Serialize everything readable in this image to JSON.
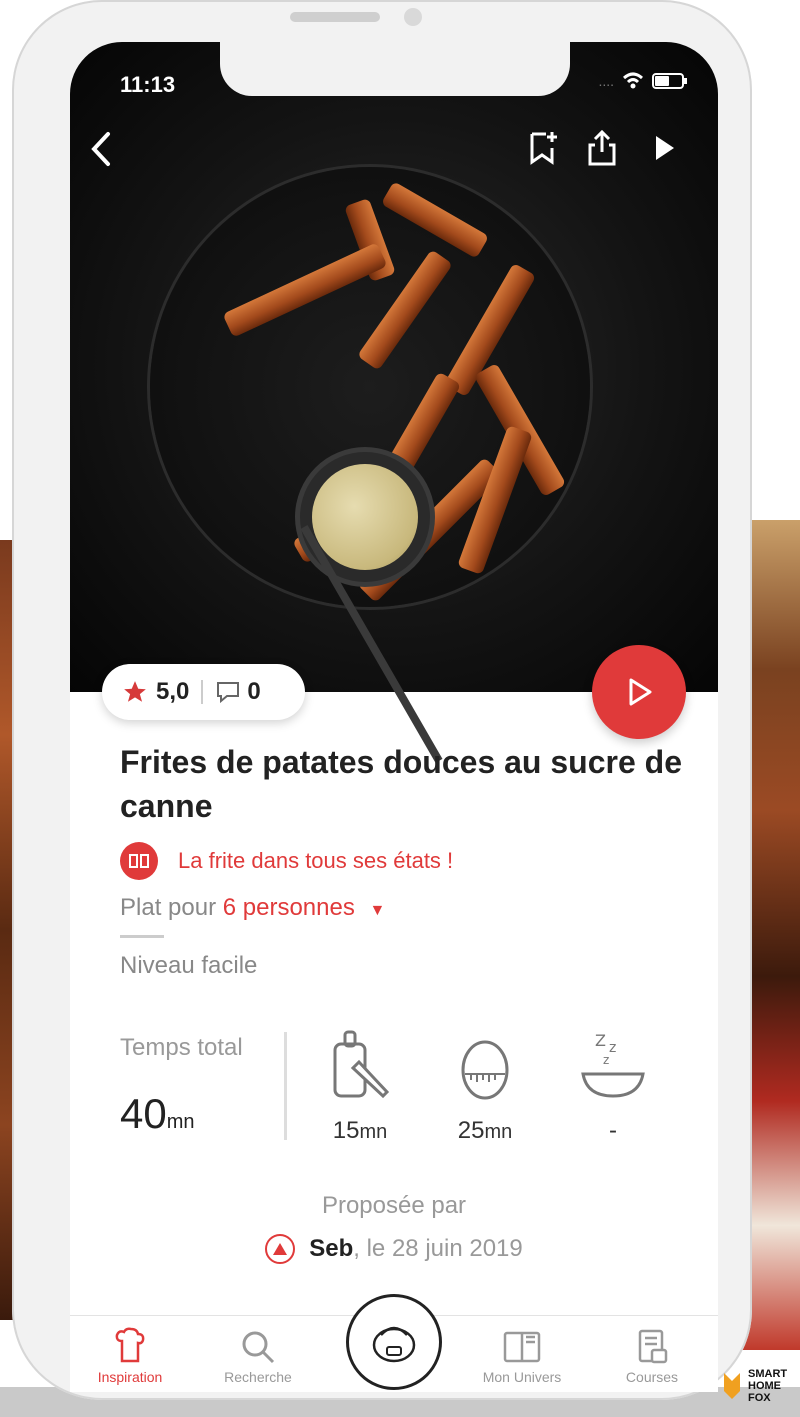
{
  "status_bar": {
    "time": "11:13"
  },
  "recipe": {
    "rating": "5,0",
    "comments": "0",
    "title": "Frites de patates douces au sucre de canne",
    "collection": "La frite dans tous ses états !",
    "servings_prefix": "Plat pour",
    "servings_value": "6 personnes",
    "level": "Niveau facile",
    "total_time_label": "Temps total",
    "total_time_value": "40",
    "total_time_unit": "mn",
    "prep_time": "15",
    "prep_unit": "mn",
    "cook_time": "25",
    "cook_unit": "mn",
    "rest_time": "-"
  },
  "author": {
    "proposed_label": "Proposée par",
    "name": "Seb",
    "date": ", le 28 juin 2019"
  },
  "nav": {
    "items": [
      {
        "label": "Inspiration",
        "icon": "chef-icon",
        "active": true
      },
      {
        "label": "Recherche",
        "icon": "search-icon"
      },
      {
        "label": "Mon Univers",
        "icon": "book-icon"
      },
      {
        "label": "Courses",
        "icon": "shopping-list-icon"
      }
    ]
  },
  "brand": {
    "line1": "SMART",
    "line2": "HOME",
    "line3": "FOX"
  },
  "colors": {
    "accent": "#e03a3a",
    "text": "#222222",
    "muted": "#888888"
  }
}
